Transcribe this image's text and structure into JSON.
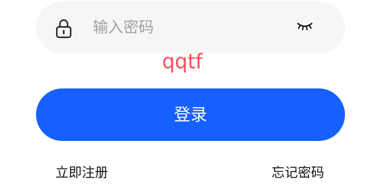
{
  "password_field": {
    "placeholder": "输入密码",
    "value": "",
    "lock_icon": "lock-icon",
    "toggle_icon": "eye-closed-icon"
  },
  "captcha": {
    "text": "qqtf",
    "color": "#ff4a5b"
  },
  "login_button": {
    "label": "登录",
    "color": "#1560ff"
  },
  "links": {
    "register": "立即注册",
    "forgot_password": "忘记密码"
  }
}
